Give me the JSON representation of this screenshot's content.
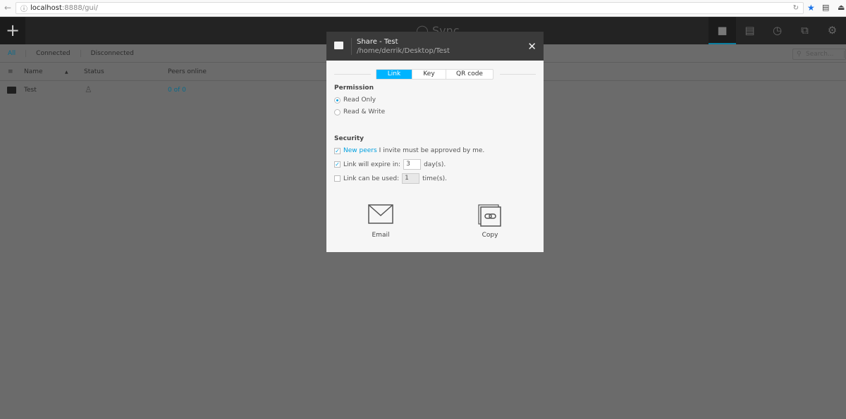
{
  "browser": {
    "url_host": "localhost",
    "url_rest": ":8888/gui/"
  },
  "app": {
    "logo": "◯ Sync",
    "add_icon": "+"
  },
  "filters": [
    "All",
    "Connected",
    "Disconnected"
  ],
  "search": {
    "placeholder": "Search..."
  },
  "table": {
    "headers": [
      "Name",
      "Status",
      "Peers online"
    ],
    "rows": [
      {
        "name": "Test",
        "peers": "0 of 0"
      }
    ]
  },
  "modal": {
    "title": "Share - Test",
    "path": "/home/derrik/Desktop/Test",
    "tabs": [
      "Link",
      "Key",
      "QR code"
    ],
    "permission_label": "Permission",
    "permissions": [
      "Read Only",
      "Read & Write"
    ],
    "selected_permission": "Read Only",
    "security_label": "Security",
    "new_peers_link": "New peers",
    "new_peers_text": "I invite must be approved by me.",
    "new_peers_checked": true,
    "expire_label": "Link will expire in:",
    "expire_value": "3",
    "expire_unit": "day(s).",
    "expire_checked": true,
    "uses_label": "Link can be used:",
    "uses_value": "1",
    "uses_unit": "time(s).",
    "uses_checked": false,
    "email_label": "Email",
    "copy_label": "Copy"
  },
  "colors": {
    "accent": "#00b4ff",
    "topbar": "#232323"
  }
}
